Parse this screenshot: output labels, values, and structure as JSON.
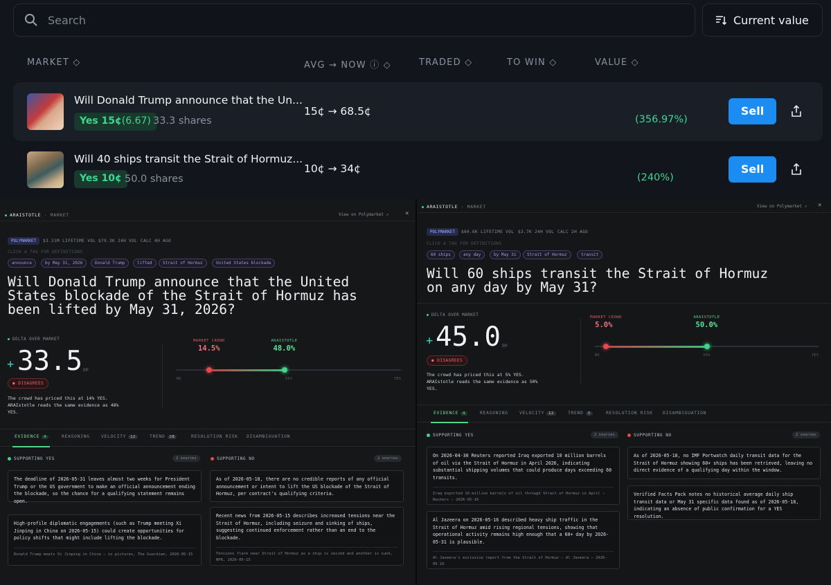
{
  "top": {
    "search_placeholder": "Search",
    "sort_label": "Current value",
    "columns": [
      "MARKET ◇",
      "AVG → NOW ⓘ ◇",
      "TRADED ◇",
      "TO WIN ◇",
      "VALUE ◇"
    ],
    "rows": [
      {
        "title": "Will Donald Trump announce that the Un...",
        "yes_label": "Yes 15¢",
        "yes_extra": "(6.67)",
        "shares": "33.3 shares",
        "price": "15¢ → 68.5¢",
        "gain": "(356.97%)",
        "sell": "Sell",
        "thumb_icon": "trump-photo-icon"
      },
      {
        "title": "Will 40 ships transit the Strait of Hormuz...",
        "yes_label": "Yes 10¢",
        "yes_extra": "",
        "shares": "50.0 shares",
        "price": "10¢ → 34¢",
        "gain": "(240%)",
        "sell": "Sell",
        "thumb_icon": "strait-map-icon"
      }
    ],
    "colors": {
      "accent": "#1b8cf2",
      "green": "#3fd693"
    }
  },
  "panel1": {
    "brand": "ARAISTOTLE",
    "crumb": "· MARKET",
    "view": "View on Polymarket ↗",
    "close": "×",
    "source": "POLYMARKET",
    "stats": [
      "$3.31M LIFETIME VOL",
      "$79.3K 24H VOL",
      "CALC 4H AGO"
    ],
    "tag_hint": "CLICK A TAG FOR DEFINITIONS",
    "tags": [
      "announce",
      "by May 31, 2026",
      "Donald Trump",
      "lifted",
      "Strait of Hormuz",
      "United States blockade"
    ],
    "title_lines": [
      "Will Donald Trump announce that the United",
      "States blockade of the Strait of Hormuz has",
      "been lifted by May 31, 2026?"
    ],
    "delta_label": "DELTA OVER MARKET",
    "delta": "33.5",
    "unit": "pp",
    "verdict": "● DISAGREES",
    "explain_lines": [
      "The crowd has priced this at 14% YES.",
      "ARAIstotle reads the same evidence as 48%",
      "YES."
    ],
    "crowd_label": "MARKET CROWD",
    "crowd_value": "14.5%",
    "ara_label": "ARAISTOTLE",
    "ara_value": "48.0%",
    "crowd_frac": 0.145,
    "ara_frac": 0.48,
    "scale": [
      "NO",
      "50%",
      "YES"
    ],
    "tabs": [
      {
        "label": "EVIDENCE",
        "count": "4"
      },
      {
        "label": "REASONING",
        "count": ""
      },
      {
        "label": "VELOCITY",
        "count": "12"
      },
      {
        "label": "TREND",
        "count": "28"
      },
      {
        "label": "RESOLUTION RISK",
        "count": ""
      },
      {
        "label": "DISAMBIGUATION",
        "count": ""
      }
    ],
    "yes_head": "SUPPORTING YES",
    "no_head": "SUPPORTING NO",
    "yes_sources": "2 sources",
    "no_sources": "2 sources",
    "yes_cards": [
      {
        "text": "The deadline of 2026-05-31 leaves almost two weeks for President Trump or the US government to make an official announcement ending the blockade, so the chance for a qualifying statement remains open.",
        "cite": ""
      },
      {
        "text": "High-profile diplomatic engagements (such as Trump meeting Xi Jinping in China on 2026-05-15) could create opportunities for policy shifts that might include lifting the blockade.",
        "cite": "Donald Trump meets Xi Jinping in China – in pictures, The Guardian, 2026-05-15"
      }
    ],
    "no_cards": [
      {
        "text": "As of 2026-05-18, there are no credible reports of any official announcement or intent to lift the US blockade of the Strait of Hormuz, per contract's qualifying criteria.",
        "cite": ""
      },
      {
        "text": "Recent news from 2026-05-15 describes increased tensions near the Strait of Hormuz, including seizure and sinking of ships, suggesting continued enforcement rather than an end to the blockade.",
        "cite": "Tensions flare near Strait of Hormuz as a ship is seized and another is sunk, NPR, 2026-05-15"
      }
    ]
  },
  "panel2": {
    "brand": "ARAISTOTLE",
    "crumb": "· MARKET",
    "view": "View on Polymarket ↗",
    "close": "×",
    "source": "POLYMARKET",
    "stats": [
      "$60.6K LIFETIME VOL",
      "$3.7K 24H VOL",
      "CALC 2H AGO"
    ],
    "tag_hint": "CLICK A TAG FOR DEFINITIONS",
    "tags": [
      "60 ships",
      "any day",
      "by May 31",
      "Strait of Hormuz",
      "transit"
    ],
    "title_lines": [
      "Will 60 ships transit the Strait of Hormuz",
      "on any day by May 31?"
    ],
    "delta_label": "DELTA OVER MARKET",
    "delta": "45.0",
    "unit": "pp",
    "verdict": "● DISAGREES",
    "explain_lines": [
      "The crowd has priced this at 5% YES.",
      "ARAIstotle reads the same evidence as 50%",
      "YES."
    ],
    "crowd_label": "MARKET CROWD",
    "crowd_value": "5.0%",
    "ara_label": "ARAISTOTLE",
    "ara_value": "50.0%",
    "crowd_frac": 0.05,
    "ara_frac": 0.5,
    "scale": [
      "NO",
      "50%",
      "YES"
    ],
    "tabs": [
      {
        "label": "EVIDENCE",
        "count": "4"
      },
      {
        "label": "REASONING",
        "count": ""
      },
      {
        "label": "VELOCITY",
        "count": "12"
      },
      {
        "label": "TREND",
        "count": "3"
      },
      {
        "label": "RESOLUTION RISK",
        "count": ""
      },
      {
        "label": "DISAMBIGUATION",
        "count": ""
      }
    ],
    "yes_head": "SUPPORTING YES",
    "no_head": "SUPPORTING NO",
    "yes_sources": "2 sources",
    "no_sources": "2 sources",
    "yes_cards": [
      {
        "text": "On 2026-04-30 Reuters reported Iraq exported 10 million barrels of oil via the Strait of Hormuz in April 2026, indicating substantial shipping volumes that could produce days exceeding 60 transits.",
        "cite": "Iraq exported 10 million barrels of oil through Strait of Hormuz in April – Reuters – 2026-05-16"
      },
      {
        "text": "Al Jazeera on 2026-05-16 described heavy ship traffic in the Strait of Hormuz amid rising regional tensions, showing that operational activity remains high enough that a 60+ day by 2026-05-31 is plausible.",
        "cite": "Al Jazeera's exclusive report from the Strait of Hormuz – Al Jazeera – 2026-05-16"
      }
    ],
    "no_cards": [
      {
        "text": "As of 2026-05-18, no IMF Portwatch daily transit data for the Strait of Hormuz showing 60+ ships has been retrieved, leaving no direct evidence of a qualifying day within the window.",
        "cite": ""
      },
      {
        "text": "Verified Facts Pack notes no historical average daily ship transit data or May 31 specific data found as of 2026-05-18, indicating an absence of public confirmation for a YES resolution.",
        "cite": ""
      }
    ]
  }
}
